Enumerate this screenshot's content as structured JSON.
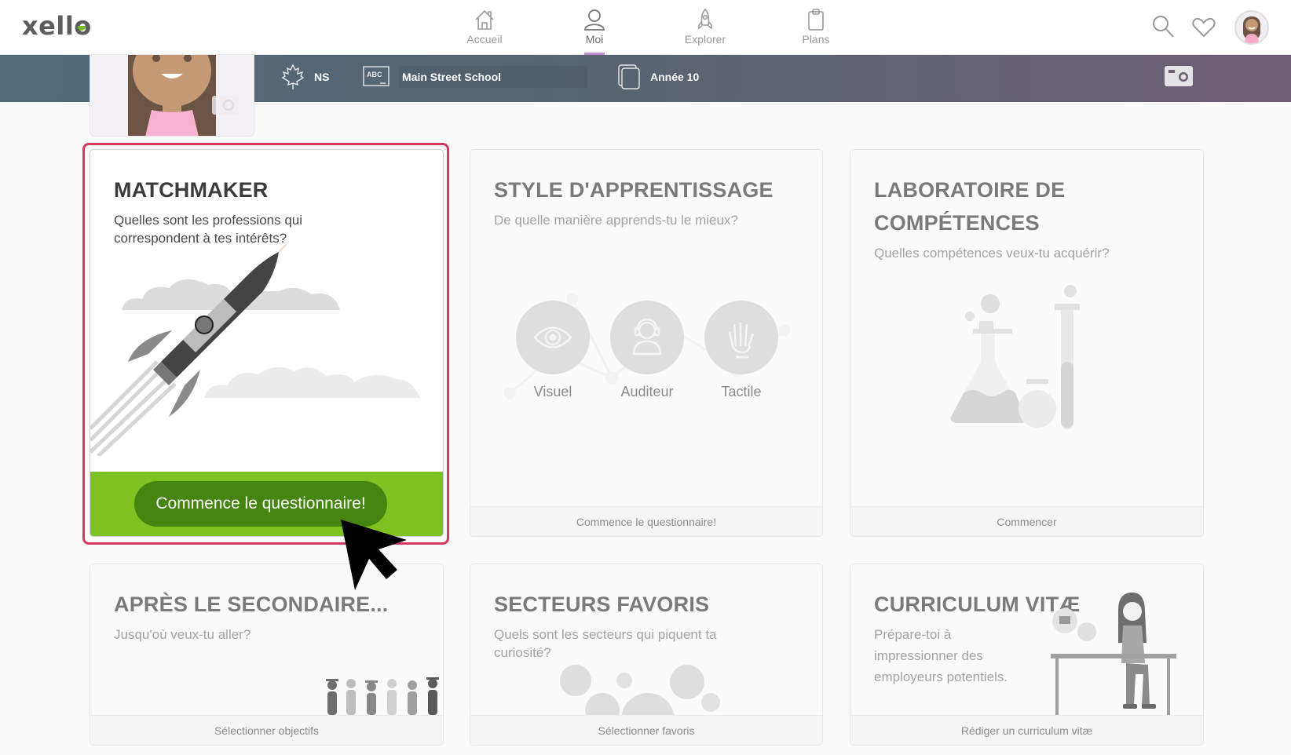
{
  "header": {
    "logo": "xello",
    "nav": [
      {
        "label": "Accueil",
        "icon": "home-icon",
        "active": false
      },
      {
        "label": "Moi",
        "icon": "user-icon",
        "active": true
      },
      {
        "label": "Explorer",
        "icon": "rocket-icon",
        "active": false
      },
      {
        "label": "Plans",
        "icon": "clipboard-icon",
        "active": false
      }
    ],
    "actions": [
      "search-icon",
      "heart-icon",
      "avatar"
    ]
  },
  "profile_banner": {
    "province": "NS",
    "school": "Main Street School",
    "grade": "Année 10"
  },
  "cards": [
    {
      "title": "MATCHMAKER",
      "subtitle": "Quelles sont les professions qui correspondent à tes intérêts?",
      "action": "Commence le questionnaire!",
      "active": true
    },
    {
      "title": "STYLE D'APPRENTISSAGE",
      "subtitle": "De quelle manière apprends-tu le mieux?",
      "styles": [
        "Visuel",
        "Auditeur",
        "Tactile"
      ],
      "action": "Commence le questionnaire!"
    },
    {
      "title_line1": "LABORATOIRE DE",
      "title_line2": "COMPÉTENCES",
      "subtitle": "Quelles compétences veux-tu acquérir?",
      "action": "Commencer"
    },
    {
      "title": "APRÈS LE SECONDAIRE...",
      "subtitle": "Jusqu'où veux-tu aller?",
      "action": "Sélectionner objectifs"
    },
    {
      "title": "SECTEURS FAVORIS",
      "subtitle_line1": "Quels sont les secteurs qui piquent ta",
      "subtitle_line2": "curiosité?",
      "action": "Sélectionner favoris"
    },
    {
      "title": "CURRICULUM VITÆ",
      "subtitle_line1": "Prépare-toi à",
      "subtitle_line2": "impressionner des",
      "subtitle_line3": "employeurs potentiels.",
      "action": "Rédiger un curriculum vitæ"
    }
  ],
  "colors": {
    "accent_green": "#80c122",
    "button_green": "#468410",
    "highlight_red": "#d6395f",
    "nav_active_underline": "#c48ad6"
  }
}
